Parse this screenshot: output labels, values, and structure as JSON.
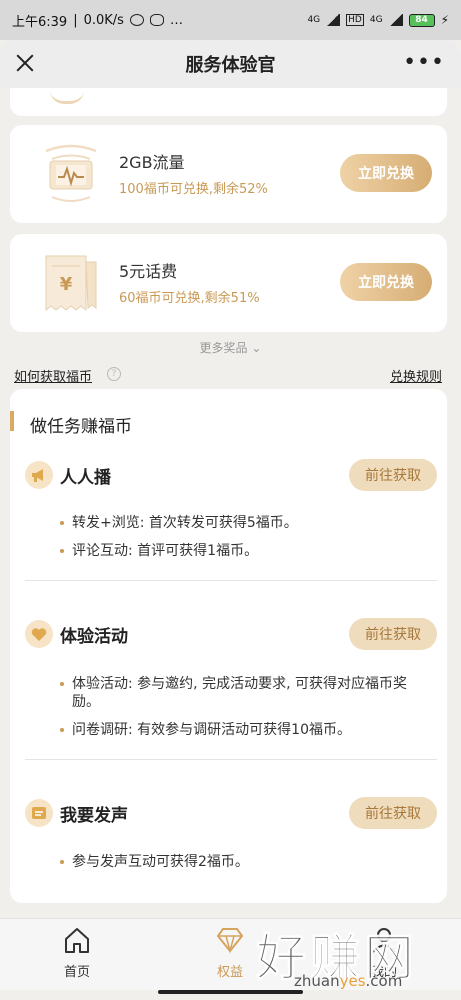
{
  "status_bar": {
    "time": "上午6:39",
    "speed": "0.0K/s",
    "network1": "4G",
    "hd": "HD",
    "network2": "4G",
    "battery": "84"
  },
  "titlebar": {
    "title": "服务体验官",
    "more": "•••"
  },
  "prizes": [
    {
      "name": "2GB流量",
      "desc": "100福币可兑换,剩余52%",
      "button": "立即兑换",
      "icon": "data-traffic-icon"
    },
    {
      "name": "5元话费",
      "desc": "60福币可兑换,剩余51%",
      "button": "立即兑换",
      "icon": "phone-bill-ticket-icon"
    }
  ],
  "more_prizes": "更多奖品",
  "links": {
    "how_to_get": "如何获取福币",
    "help": "?",
    "rules": "兑换规则"
  },
  "tasks": {
    "header": "做任务赚福币",
    "items": [
      {
        "title": "人人播",
        "button": "前往获取",
        "icon": "megaphone-icon",
        "bullets": [
          "转发+浏览: 首次转发可获得5福币。",
          "评论互动: 首评可获得1福币。"
        ]
      },
      {
        "title": "体验活动",
        "button": "前往获取",
        "icon": "heart-icon",
        "bullets": [
          "体验活动: 参与邀约, 完成活动要求, 可获得对应福币奖励。",
          "问卷调研: 有效参与调研活动可获得10福币。"
        ]
      },
      {
        "title": "我要发声",
        "button": "前往获取",
        "icon": "message-icon",
        "bullets": [
          "参与发声互动可获得2福币。"
        ]
      }
    ]
  },
  "tabbar": [
    {
      "label": "首页",
      "icon": "home-icon"
    },
    {
      "label": "权益",
      "icon": "diamond-icon",
      "active": true
    },
    {
      "label": "我的",
      "icon": "user-icon"
    }
  ],
  "watermark": {
    "big": "好赚网",
    "small_pre": "zhuan",
    "small_yes": "yes",
    "small_post": ".com"
  },
  "colors": {
    "accent": "#c99a55",
    "button_gold": "#d6ad74",
    "task_button_bg": "#efdcbd"
  }
}
